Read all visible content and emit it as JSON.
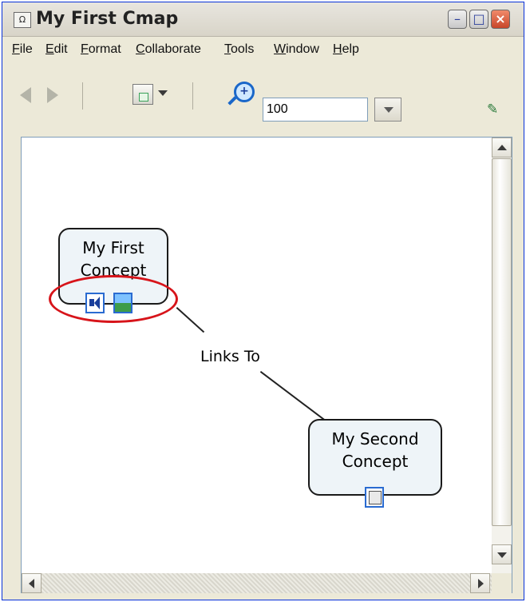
{
  "window": {
    "title": "My First Cmap",
    "app_icon_glyph": "Ω",
    "minimize": "–",
    "maximize": "□",
    "close": "×"
  },
  "menu": [
    "File",
    "Edit",
    "Format",
    "Collaborate",
    "Tools",
    "Window",
    "Help"
  ],
  "toolbar": {
    "zoom_value": "100",
    "right_icon_glyph": "✎"
  },
  "map": {
    "concept_1": {
      "line1": "My First",
      "line2": "Concept"
    },
    "concept_2": {
      "line1": "My Second",
      "line2": "Concept"
    },
    "link_label": "Links To"
  },
  "colors": {
    "highlight": "#d7141a",
    "node_fill": "#eef4f8",
    "resource_icon_border": "#2a6bd1",
    "toolbar_bg": "#ece9d8"
  },
  "icons": [
    "app-icon",
    "back-icon",
    "forward-icon",
    "view-icon",
    "zoom-icon",
    "audio-icon",
    "image-icon",
    "document-icon"
  ]
}
